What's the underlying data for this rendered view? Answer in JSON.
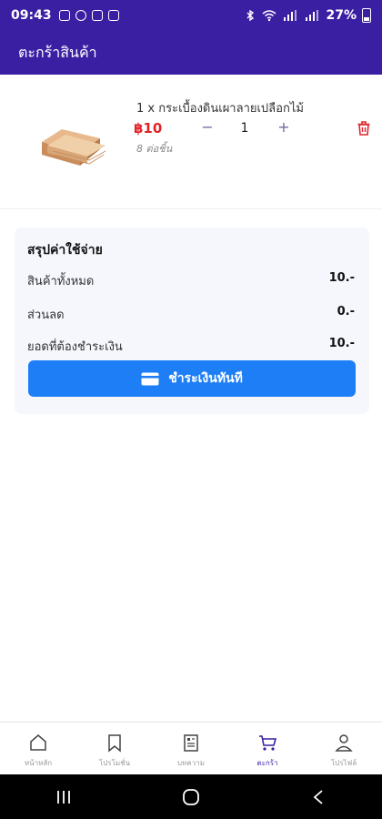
{
  "status_bar": {
    "time": "09:43",
    "battery": "27%"
  },
  "app_bar": {
    "title": "ตะกร้าสินค้า"
  },
  "cart_item": {
    "name": "1 x กระเบื้องดินเผาลายเปลือกไม้",
    "price": "฿10",
    "unit": "8 ต่อชิ้น",
    "quantity": "1",
    "minus_label": "−",
    "plus_label": "+"
  },
  "summary": {
    "title": "สรุปค่าใช้จ่าย",
    "rows": [
      {
        "label": "สินค้าทั้งหมด",
        "value": "10.-"
      },
      {
        "label": "ส่วนลด",
        "value": "0.-"
      },
      {
        "label": "ยอดที่ต้องชำระเงิน",
        "value": "10.-"
      }
    ],
    "pay_button": "ชำระเงินทันที"
  },
  "bottom_nav": {
    "items": [
      {
        "label": "หน้าหลัก",
        "icon": "home-icon"
      },
      {
        "label": "โปรโมชั่น",
        "icon": "bookmark-icon"
      },
      {
        "label": "บทความ",
        "icon": "article-icon"
      },
      {
        "label": "ตะกร้า",
        "icon": "cart-icon"
      },
      {
        "label": "โปรไฟล์",
        "icon": "profile-icon"
      }
    ],
    "active_index": 3
  },
  "colors": {
    "primary": "#3b1fa3",
    "accent_button": "#1e7ef5",
    "price": "#e0252a",
    "summary_bg": "#f5f7fd"
  }
}
